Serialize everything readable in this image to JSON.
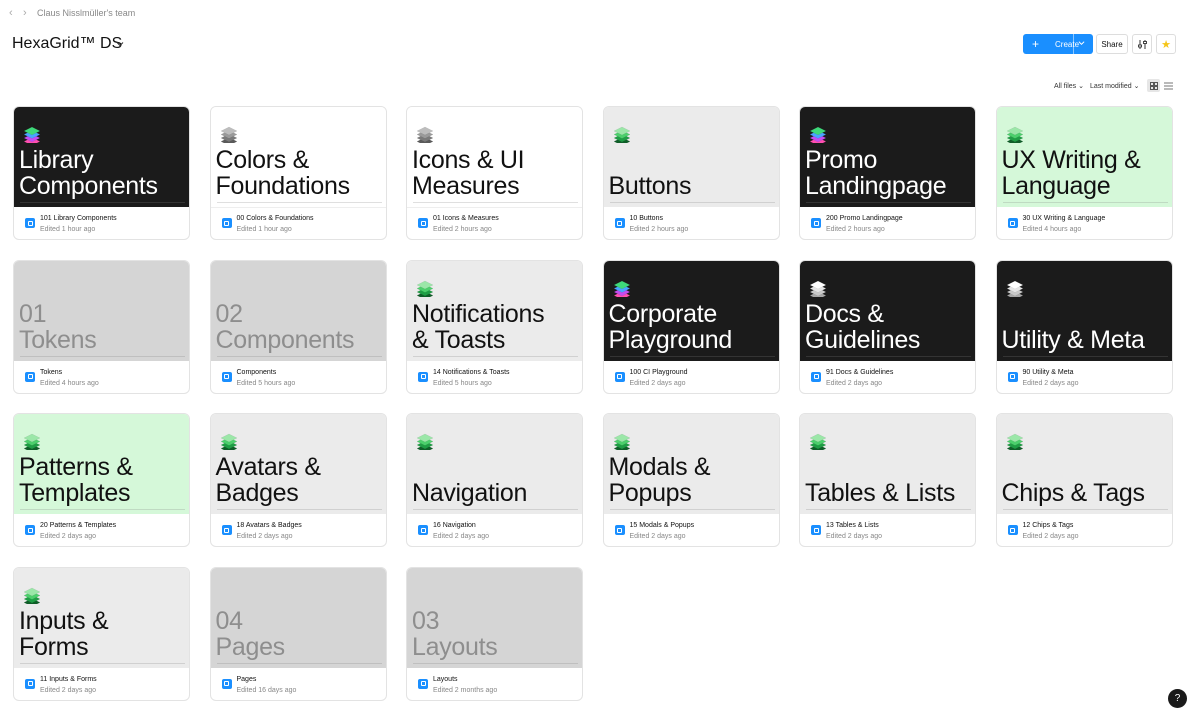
{
  "header": {
    "back_arrow": "‹",
    "forward_arrow": "›",
    "team_name": "Claus Nisslmüller's team",
    "project_title": "HexaGrid™ DS",
    "title_chevron": "⌄",
    "create_label": "Create",
    "share_label": "Share"
  },
  "toolbar": {
    "all_files_label": "All files",
    "sort_label": "Last modified"
  },
  "colors": {
    "accent": "#1a8fff",
    "dark_thumb": "#1b1b1b",
    "light_thumb": "#ebebeb",
    "grey_thumb": "#d5d5d5",
    "green_thumb": "#d5f8d9",
    "star": "#f5c518"
  },
  "cards": [
    {
      "thumb_title": "Library\nComponents",
      "file_name": "101 Library Components",
      "edited": "Edited 1 hour ago",
      "style": "dark",
      "icon": "rainbow"
    },
    {
      "thumb_title": "Colors &\nFoundations",
      "file_name": "00 Colors & Foundations",
      "edited": "Edited 1 hour ago",
      "style": "white",
      "icon": "grey"
    },
    {
      "thumb_title": "Icons & UI\nMeasures",
      "file_name": "01 Icons & Measures",
      "edited": "Edited 2 hours ago",
      "style": "white",
      "icon": "grey"
    },
    {
      "thumb_title": "Buttons",
      "file_name": "10 Buttons",
      "edited": "Edited 2 hours ago",
      "style": "light",
      "icon": "green"
    },
    {
      "thumb_title": "Promo\nLandingpage",
      "file_name": "200 Promo Landingpage",
      "edited": "Edited 2 hours ago",
      "style": "dark",
      "icon": "rainbow"
    },
    {
      "thumb_title": "UX Writing &\nLanguage",
      "file_name": "30 UX Writing & Language",
      "edited": "Edited 4 hours ago",
      "style": "green",
      "icon": "green"
    },
    {
      "thumb_title": "01\nTokens",
      "file_name": "Tokens",
      "edited": "Edited 4 hours ago",
      "style": "grey",
      "icon": "none"
    },
    {
      "thumb_title": "02\nComponents",
      "file_name": "Components",
      "edited": "Edited 5 hours ago",
      "style": "grey",
      "icon": "none"
    },
    {
      "thumb_title": "Notifications\n& Toasts",
      "file_name": "14 Notifications & Toasts",
      "edited": "Edited 5 hours ago",
      "style": "light",
      "icon": "green"
    },
    {
      "thumb_title": "Corporate\nPlayground",
      "file_name": "100 CI Playground",
      "edited": "Edited 2 days ago",
      "style": "dark",
      "icon": "rainbow"
    },
    {
      "thumb_title": "Docs &\nGuidelines",
      "file_name": "91 Docs & Guidelines",
      "edited": "Edited 2 days ago",
      "style": "dark",
      "icon": "white"
    },
    {
      "thumb_title": "Utility & Meta",
      "file_name": "90 Utility & Meta",
      "edited": "Edited 2 days ago",
      "style": "dark",
      "icon": "white"
    },
    {
      "thumb_title": "Patterns &\nTemplates",
      "file_name": "20 Patterns & Templates",
      "edited": "Edited 2 days ago",
      "style": "green",
      "icon": "green"
    },
    {
      "thumb_title": "Avatars &\nBadges",
      "file_name": "18 Avatars & Badges",
      "edited": "Edited 2 days ago",
      "style": "light",
      "icon": "green"
    },
    {
      "thumb_title": "Navigation",
      "file_name": "16 Navigation",
      "edited": "Edited 2 days ago",
      "style": "light",
      "icon": "green"
    },
    {
      "thumb_title": "Modals &\nPopups",
      "file_name": "15 Modals & Popups",
      "edited": "Edited 2 days ago",
      "style": "light",
      "icon": "green"
    },
    {
      "thumb_title": "Tables & Lists",
      "file_name": "13 Tables & Lists",
      "edited": "Edited 2 days ago",
      "style": "light",
      "icon": "green"
    },
    {
      "thumb_title": "Chips & Tags",
      "file_name": "12 Chips & Tags",
      "edited": "Edited 2 days ago",
      "style": "light",
      "icon": "green"
    },
    {
      "thumb_title": "Inputs &\nForms",
      "file_name": "11 Inputs & Forms",
      "edited": "Edited 2 days ago",
      "style": "light",
      "icon": "green"
    },
    {
      "thumb_title": "04\nPages",
      "file_name": "Pages",
      "edited": "Edited 16 days ago",
      "style": "grey",
      "icon": "none"
    },
    {
      "thumb_title": "03\nLayouts",
      "file_name": "Layouts",
      "edited": "Edited 2 months ago",
      "style": "grey",
      "icon": "none"
    }
  ],
  "help_label": "?"
}
